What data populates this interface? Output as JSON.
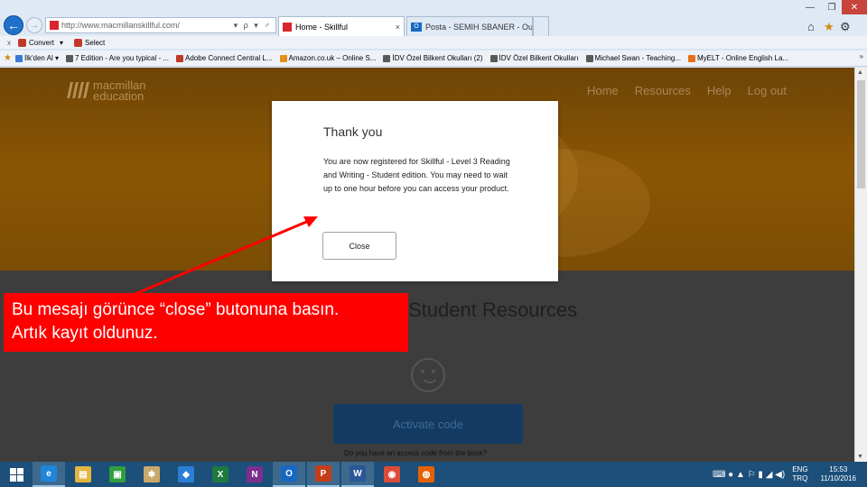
{
  "browser": {
    "address_url": "http://www.macmillanskillful.com/",
    "address_controls": "▾ ρ ▾ ♂",
    "tabs": [
      {
        "label": "Home - Skillful",
        "close": "×"
      },
      {
        "label": "Posta - SEMIH SBANER - Outl..."
      }
    ],
    "window_controls": {
      "minimize": "—",
      "maximize": "❐",
      "close": "✕"
    },
    "command_bar": {
      "close": "x",
      "convert": "Convert",
      "convert_arrow": "▾",
      "select": "Select"
    },
    "favorites": [
      "İlk'den Al ▾",
      "7 Edition - Are you typical - ...",
      "Adobe Connect Central L...",
      "Amazon.co.uk – Online S...",
      "İDV Özel Bilkent Okulları (2)",
      "İDV Özel Bilkent Okulları",
      "Michael Swan - Teaching...",
      "MyELT - Online English La..."
    ],
    "favorites_more": "»",
    "accent_color": "#1e72c9"
  },
  "page": {
    "logo_line1": "macmillan",
    "logo_line2": "education",
    "nav": [
      "Home",
      "Resources",
      "Help",
      "Log out"
    ],
    "heading": "Student Resources",
    "activate_button": "Activate code",
    "access_question": "Do you have an access code from the book?"
  },
  "modal": {
    "title": "Thank you",
    "body": "You are now registered for Skillful - Level 3 Reading and Writing - Student edition. You may need to wait up to one hour before you can access your product.",
    "close_button": "Close"
  },
  "annotation": {
    "callout_line1": "Bu mesajı görünce “close” butonuna basın.",
    "callout_line2": "Artık kayıt oldunuz.",
    "color": "#ff0000"
  },
  "taskbar": {
    "apps": [
      {
        "name": "ie",
        "label": "e",
        "color": "#1f86d9",
        "active": true
      },
      {
        "name": "explorer",
        "label": "▤",
        "color": "#e2b440"
      },
      {
        "name": "store",
        "label": "▣",
        "color": "#2e9e3e"
      },
      {
        "name": "paint",
        "label": "✱",
        "color": "#c9a86a"
      },
      {
        "name": "dropbox",
        "label": "◆",
        "color": "#2a7fd4"
      },
      {
        "name": "excel",
        "label": "X",
        "color": "#1d7a3f"
      },
      {
        "name": "onenote",
        "label": "N",
        "color": "#7b2f8f"
      },
      {
        "name": "outlook",
        "label": "O",
        "color": "#1668c2",
        "active": true
      },
      {
        "name": "powerpoint",
        "label": "P",
        "color": "#c43e1c",
        "active": true
      },
      {
        "name": "word",
        "label": "W",
        "color": "#2b5797",
        "active": true
      },
      {
        "name": "chrome",
        "label": "◉",
        "color": "#dd4b39"
      },
      {
        "name": "firefox",
        "label": "◍",
        "color": "#e66000"
      }
    ],
    "tray_icons": "⌨ ● ▲ ⚐ ▮ ◢ ◀)",
    "lang_top": "ENG",
    "lang_bottom": "TRQ",
    "time": "15:53",
    "date": "11/10/2016"
  }
}
